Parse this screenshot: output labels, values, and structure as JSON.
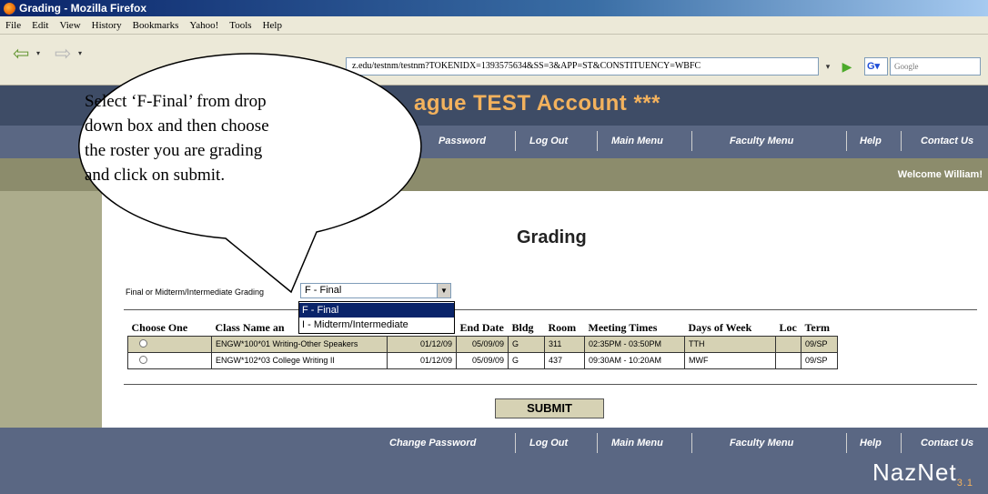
{
  "window": {
    "title": "Grading - Mozilla Firefox"
  },
  "menu": [
    "File",
    "Edit",
    "View",
    "History",
    "Bookmarks",
    "Yahoo!",
    "Tools",
    "Help"
  ],
  "toolbar": {
    "url": "z.edu/testnm/testnm?TOKENIDX=1393575634&SS=3&APP=ST&CONSTITUENCY=WBFC",
    "search_placeholder": "Google"
  },
  "banner": {
    "title": "ague TEST Account ***"
  },
  "nav": {
    "password": "Password",
    "change_password": "Change Password",
    "logout": "Log Out",
    "main_menu": "Main Menu",
    "faculty_menu": "Faculty Menu",
    "help": "Help",
    "contact": "Contact Us"
  },
  "welcome": "Welcome William!",
  "page": {
    "heading": "Grading",
    "select_label": "Final or Midterm/Intermediate Grading",
    "select_value": "F - Final",
    "options": [
      "F - Final",
      "I - Midterm/Intermediate"
    ],
    "submit": "SUBMIT"
  },
  "table": {
    "headers": [
      "Choose One",
      "Class Name an",
      "End Date",
      "Bldg",
      "Room",
      "Meeting Times",
      "Days of Week",
      "Loc",
      "Term"
    ],
    "rows": [
      {
        "class": "ENGW*100*01 Writing-Other Speakers",
        "start": "01/12/09",
        "end": "05/09/09",
        "bldg": "G",
        "room": "311",
        "times": "02:35PM - 03:50PM",
        "days": "TTH",
        "loc": "",
        "term": "09/SP"
      },
      {
        "class": "ENGW*102*03 College Writing II",
        "start": "01/12/09",
        "end": "05/09/09",
        "bldg": "G",
        "room": "437",
        "times": "09:30AM - 10:20AM",
        "days": "MWF",
        "loc": "",
        "term": "09/SP"
      }
    ]
  },
  "callout": {
    "lines": [
      "Select ‘F-Final’ from drop",
      "down box and then choose",
      "the roster you are grading",
      "and click on submit."
    ]
  },
  "logo": {
    "name": "NazNet",
    "version": "3.1"
  }
}
